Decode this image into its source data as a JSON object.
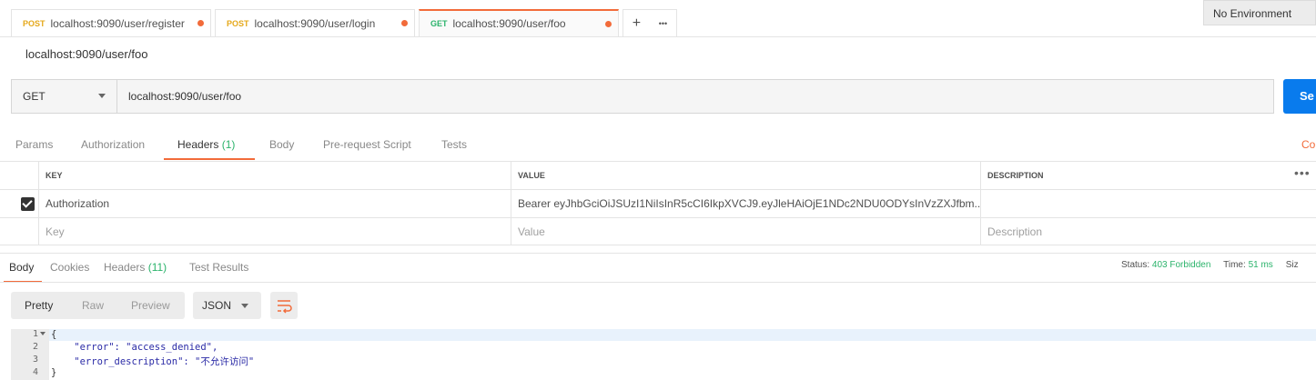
{
  "tabs": [
    {
      "method": "POST",
      "url": "localhost:9090/user/register"
    },
    {
      "method": "POST",
      "url": "localhost:9090/user/login"
    },
    {
      "method": "GET",
      "url": "localhost:9090/user/foo"
    }
  ],
  "tab_add_label": "+",
  "tab_more_label": "•••",
  "environment": "No Environment",
  "request_title": "localhost:9090/user/foo",
  "method": "GET",
  "url": "localhost:9090/user/foo",
  "send_label": "Se",
  "request_tabs": {
    "params": "Params",
    "authorization": "Authorization",
    "headers": "Headers",
    "headers_count": "(1)",
    "body": "Body",
    "prerequest": "Pre-request Script",
    "tests": "Tests",
    "code": "Co"
  },
  "headers_table": {
    "key_col": "KEY",
    "value_col": "VALUE",
    "desc_col": "DESCRIPTION",
    "more": "•••",
    "row": {
      "key": "Authorization",
      "value": "Bearer eyJhbGciOiJSUzI1NiIsInR5cCI6IkpXVCJ9.eyJleHAiOjE1NDc2NDU0ODYsInVzZXJfbm...",
      "description": ""
    },
    "placeholder": {
      "key": "Key",
      "value": "Value",
      "description": "Description"
    }
  },
  "response_tabs": {
    "body": "Body",
    "cookies": "Cookies",
    "headers": "Headers",
    "headers_count": "(11)",
    "test_results": "Test Results"
  },
  "status": {
    "status_label": "Status:",
    "status_value": "403 Forbidden",
    "time_label": "Time:",
    "time_value": "51 ms",
    "size_label": "Siz"
  },
  "format": {
    "pretty": "Pretty",
    "raw": "Raw",
    "preview": "Preview",
    "type": "JSON"
  },
  "code_lines": [
    {
      "n": "1",
      "text": "{"
    },
    {
      "n": "2",
      "text": "    \"error\": \"access_denied\","
    },
    {
      "n": "3",
      "text": "    \"error_description\": \"不允许访问\""
    },
    {
      "n": "4",
      "text": "}"
    }
  ],
  "colors": {
    "accent": "#f26b3a",
    "send": "#097bed",
    "success": "#2bb36b",
    "post": "#e5a81a"
  }
}
